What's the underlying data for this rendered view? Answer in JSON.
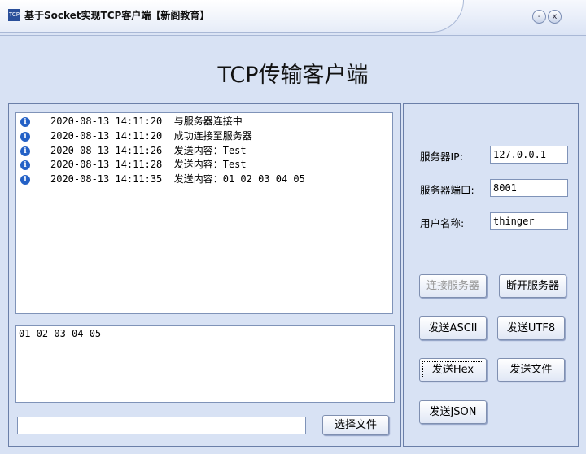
{
  "window": {
    "icon_text": "TCP",
    "title": "基于Socket实现TCP客户端【新阁教育】",
    "minimize": "-",
    "close": "x"
  },
  "heading": "TCP传输客户端",
  "log": [
    {
      "icon": "info-icon",
      "time": "2020-08-13 14:11:20",
      "msg": "与服务器连接中"
    },
    {
      "icon": "info-icon",
      "time": "2020-08-13 14:11:20",
      "msg": "成功连接至服务器"
    },
    {
      "icon": "info-icon",
      "time": "2020-08-13 14:11:26",
      "msg": "发送内容：Test"
    },
    {
      "icon": "info-icon",
      "time": "2020-08-13 14:11:28",
      "msg": "发送内容：Test"
    },
    {
      "icon": "info-icon",
      "time": "2020-08-13 14:11:35",
      "msg": "发送内容：01 02 03 04 05"
    }
  ],
  "send_text": "01 02 03 04 05",
  "file_path": "",
  "choose_file": "选择文件",
  "settings": {
    "ip_label": "服务器IP:",
    "ip": "127.0.0.1",
    "port_label": "服务器端口:",
    "port": "8001",
    "user_label": "用户名称:",
    "user": "thinger"
  },
  "buttons": {
    "connect": "连接服务器",
    "disconnect": "断开服务器",
    "ascii": "发送ASCII",
    "utf8": "发送UTF8",
    "hex": "发送Hex",
    "file": "发送文件",
    "json": "发送JSON"
  }
}
